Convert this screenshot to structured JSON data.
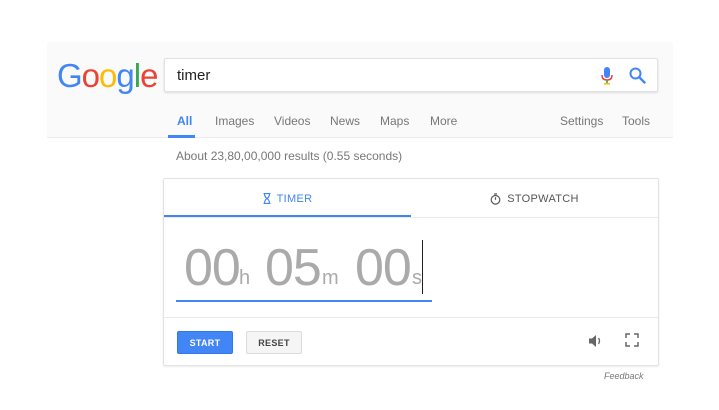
{
  "logo": {
    "letters": [
      "G",
      "o",
      "o",
      "g",
      "l",
      "e"
    ],
    "colors": [
      "#4285f4",
      "#ea4335",
      "#fbbc05",
      "#4285f4",
      "#34a853",
      "#ea4335"
    ]
  },
  "search": {
    "value": "timer",
    "mic_icon": "microphone-icon",
    "search_icon": "magnifier-icon"
  },
  "tabs": {
    "items": [
      {
        "label": "All",
        "active": true
      },
      {
        "label": "Images"
      },
      {
        "label": "Videos"
      },
      {
        "label": "News"
      },
      {
        "label": "Maps"
      },
      {
        "label": "More"
      }
    ],
    "settings": "Settings",
    "tools": "Tools"
  },
  "results": {
    "count_text": "About 23,80,00,000 results (0.55 seconds)"
  },
  "timer_card": {
    "tab_timer": "TIMER",
    "tab_stopwatch": "STOPWATCH",
    "timer_icon": "hourglass-icon",
    "stopwatch_icon": "stopwatch-icon",
    "hours": "00",
    "hours_unit": "h",
    "minutes": "05",
    "minutes_unit": "m",
    "seconds": "00",
    "seconds_unit": "s",
    "start_label": "START",
    "reset_label": "RESET",
    "volume_icon": "volume-icon",
    "fullscreen_icon": "fullscreen-icon"
  },
  "feedback": "Feedback",
  "colors": {
    "accent": "#4285f4",
    "digits": "#aaaaaa",
    "muted_text": "#777777"
  }
}
